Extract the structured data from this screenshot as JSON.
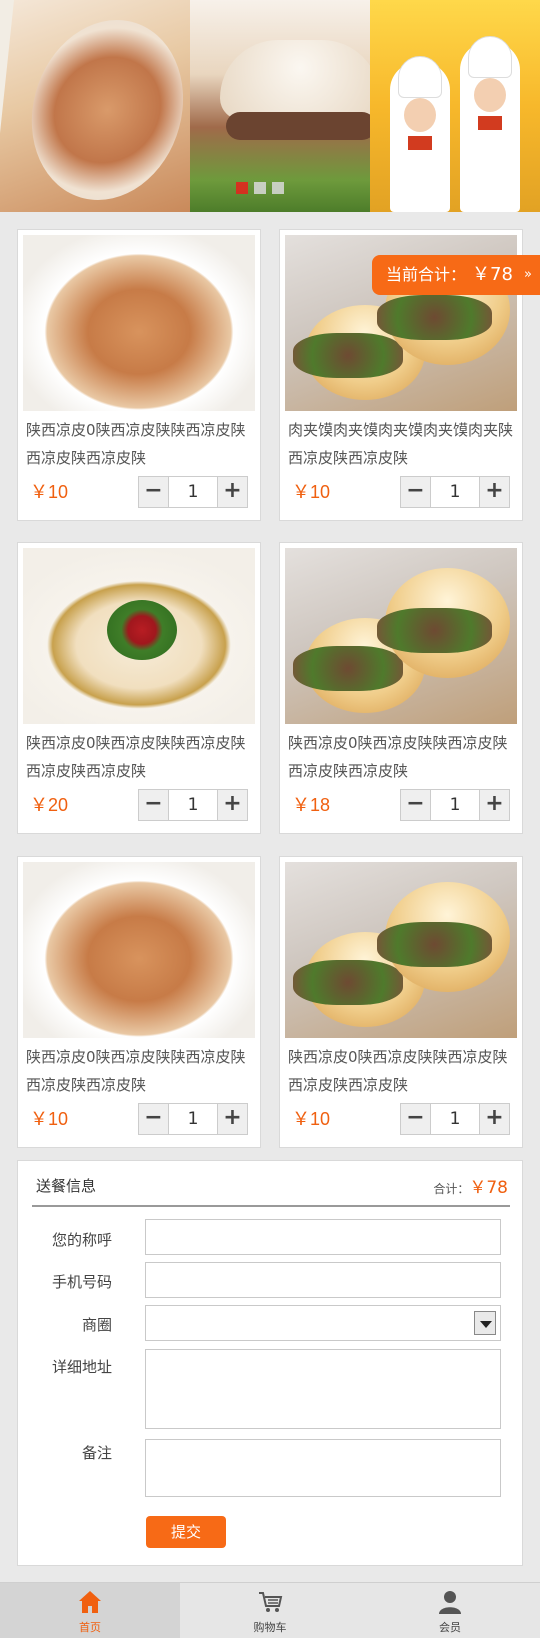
{
  "banner": {
    "slides": 3,
    "active_slide": 1
  },
  "float_total": {
    "label": "当前合计：",
    "amount": "￥78",
    "chevron": "»"
  },
  "products": [
    {
      "name": "陕西凉皮0陕西凉皮陕陕西凉皮陕西凉皮陕西凉皮陕",
      "price": "￥10",
      "qty": "1",
      "image": "noodle"
    },
    {
      "name": "肉夹馍肉夹馍肉夹馍肉夹馍肉夹陕西凉皮陕西凉皮陕",
      "price": "￥10",
      "qty": "1",
      "image": "burger"
    },
    {
      "name": "陕西凉皮0陕西凉皮陕陕西凉皮陕西凉皮陕西凉皮陕",
      "price": "￥20",
      "qty": "1",
      "image": "dumpling"
    },
    {
      "name": "陕西凉皮0陕西凉皮陕陕西凉皮陕西凉皮陕西凉皮陕",
      "price": "￥18",
      "qty": "1",
      "image": "burger"
    },
    {
      "name": "陕西凉皮0陕西凉皮陕陕西凉皮陕西凉皮陕西凉皮陕",
      "price": "￥10",
      "qty": "1",
      "image": "noodle"
    },
    {
      "name": "陕西凉皮0陕西凉皮陕陕西凉皮陕西凉皮陕西凉皮陕",
      "price": "￥10",
      "qty": "1",
      "image": "burger"
    }
  ],
  "stepper": {
    "minus": "−",
    "plus": "+"
  },
  "delivery": {
    "title": "送餐信息",
    "sum_label": "合计：",
    "sum_value": "￥78",
    "fields": {
      "name_label": "您的称呼",
      "phone_label": "手机号码",
      "district_label": "商圈",
      "address_label": "详细地址",
      "note_label": "备注"
    },
    "submit_label": "提交"
  },
  "tabs": [
    {
      "label": "首页",
      "icon": "home-icon",
      "active": true
    },
    {
      "label": "购物车",
      "icon": "cart-icon",
      "active": false
    },
    {
      "label": "会员",
      "icon": "user-icon",
      "active": false
    }
  ],
  "colors": {
    "accent": "#f76a16",
    "price": "#f06010",
    "dot_active": "#e8211c"
  }
}
